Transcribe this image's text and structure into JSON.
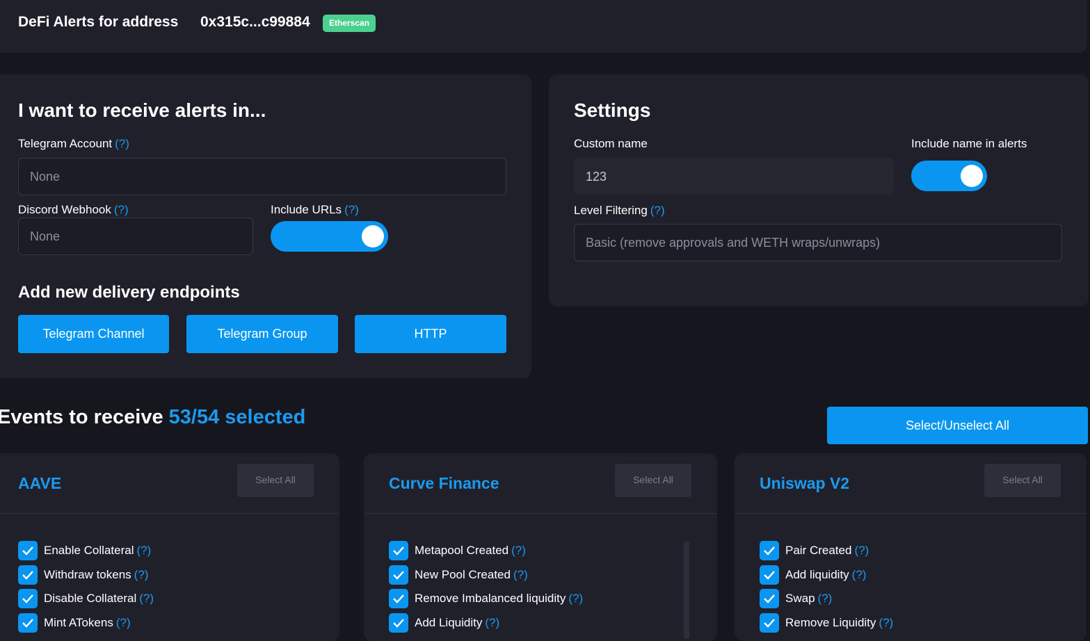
{
  "header": {
    "title": "DeFi Alerts for address",
    "address": "0x315c...c99884",
    "badge": "Etherscan"
  },
  "delivery": {
    "title": "I want to receive alerts in...",
    "telegram_label": "Telegram Account",
    "telegram_help": "(?)",
    "telegram_value": "None",
    "discord_label": "Discord Webhook",
    "discord_help": "(?)",
    "discord_value": "None",
    "urls_label": "Include URLs",
    "urls_help": "(?)",
    "urls_on": true,
    "endpoints_title": "Add new delivery endpoints",
    "buttons": [
      "Telegram Channel",
      "Telegram Group",
      "HTTP"
    ]
  },
  "settings": {
    "title": "Settings",
    "custom_name_label": "Custom name",
    "custom_name_value": "123",
    "include_name_label": "Include name in alerts",
    "include_name_on": true,
    "level_label": "Level Filtering",
    "level_help": "(?)",
    "level_value": "Basic (remove approvals and WETH wraps/unwraps)"
  },
  "events": {
    "title": "Events to receive",
    "count": "53/54 selected",
    "select_all_label": "Select/Unselect All",
    "protocols": [
      {
        "name": "AAVE",
        "select_all": "Select All",
        "items": [
          {
            "label": "Enable Collateral",
            "help": "(?)",
            "checked": true
          },
          {
            "label": "Withdraw tokens",
            "help": "(?)",
            "checked": true
          },
          {
            "label": "Disable Collateral",
            "help": "(?)",
            "checked": true
          },
          {
            "label": "Mint ATokens",
            "help": "(?)",
            "checked": true
          }
        ]
      },
      {
        "name": "Curve Finance",
        "select_all": "Select All",
        "items": [
          {
            "label": "Metapool Created",
            "help": "(?)",
            "checked": true
          },
          {
            "label": "New Pool Created",
            "help": "(?)",
            "checked": true
          },
          {
            "label": "Remove Imbalanced liquidity",
            "help": "(?)",
            "checked": true
          },
          {
            "label": "Add Liquidity",
            "help": "(?)",
            "checked": true
          }
        ]
      },
      {
        "name": "Uniswap V2",
        "select_all": "Select All",
        "items": [
          {
            "label": "Pair Created",
            "help": "(?)",
            "checked": true
          },
          {
            "label": "Add liquidity",
            "help": "(?)",
            "checked": true
          },
          {
            "label": "Swap",
            "help": "(?)",
            "checked": true
          },
          {
            "label": "Remove Liquidity",
            "help": "(?)",
            "checked": true
          }
        ]
      }
    ]
  },
  "colors": {
    "accent": "#0a96f0",
    "badge": "#4cd08f",
    "background": "#16161e",
    "card": "#20202b"
  }
}
